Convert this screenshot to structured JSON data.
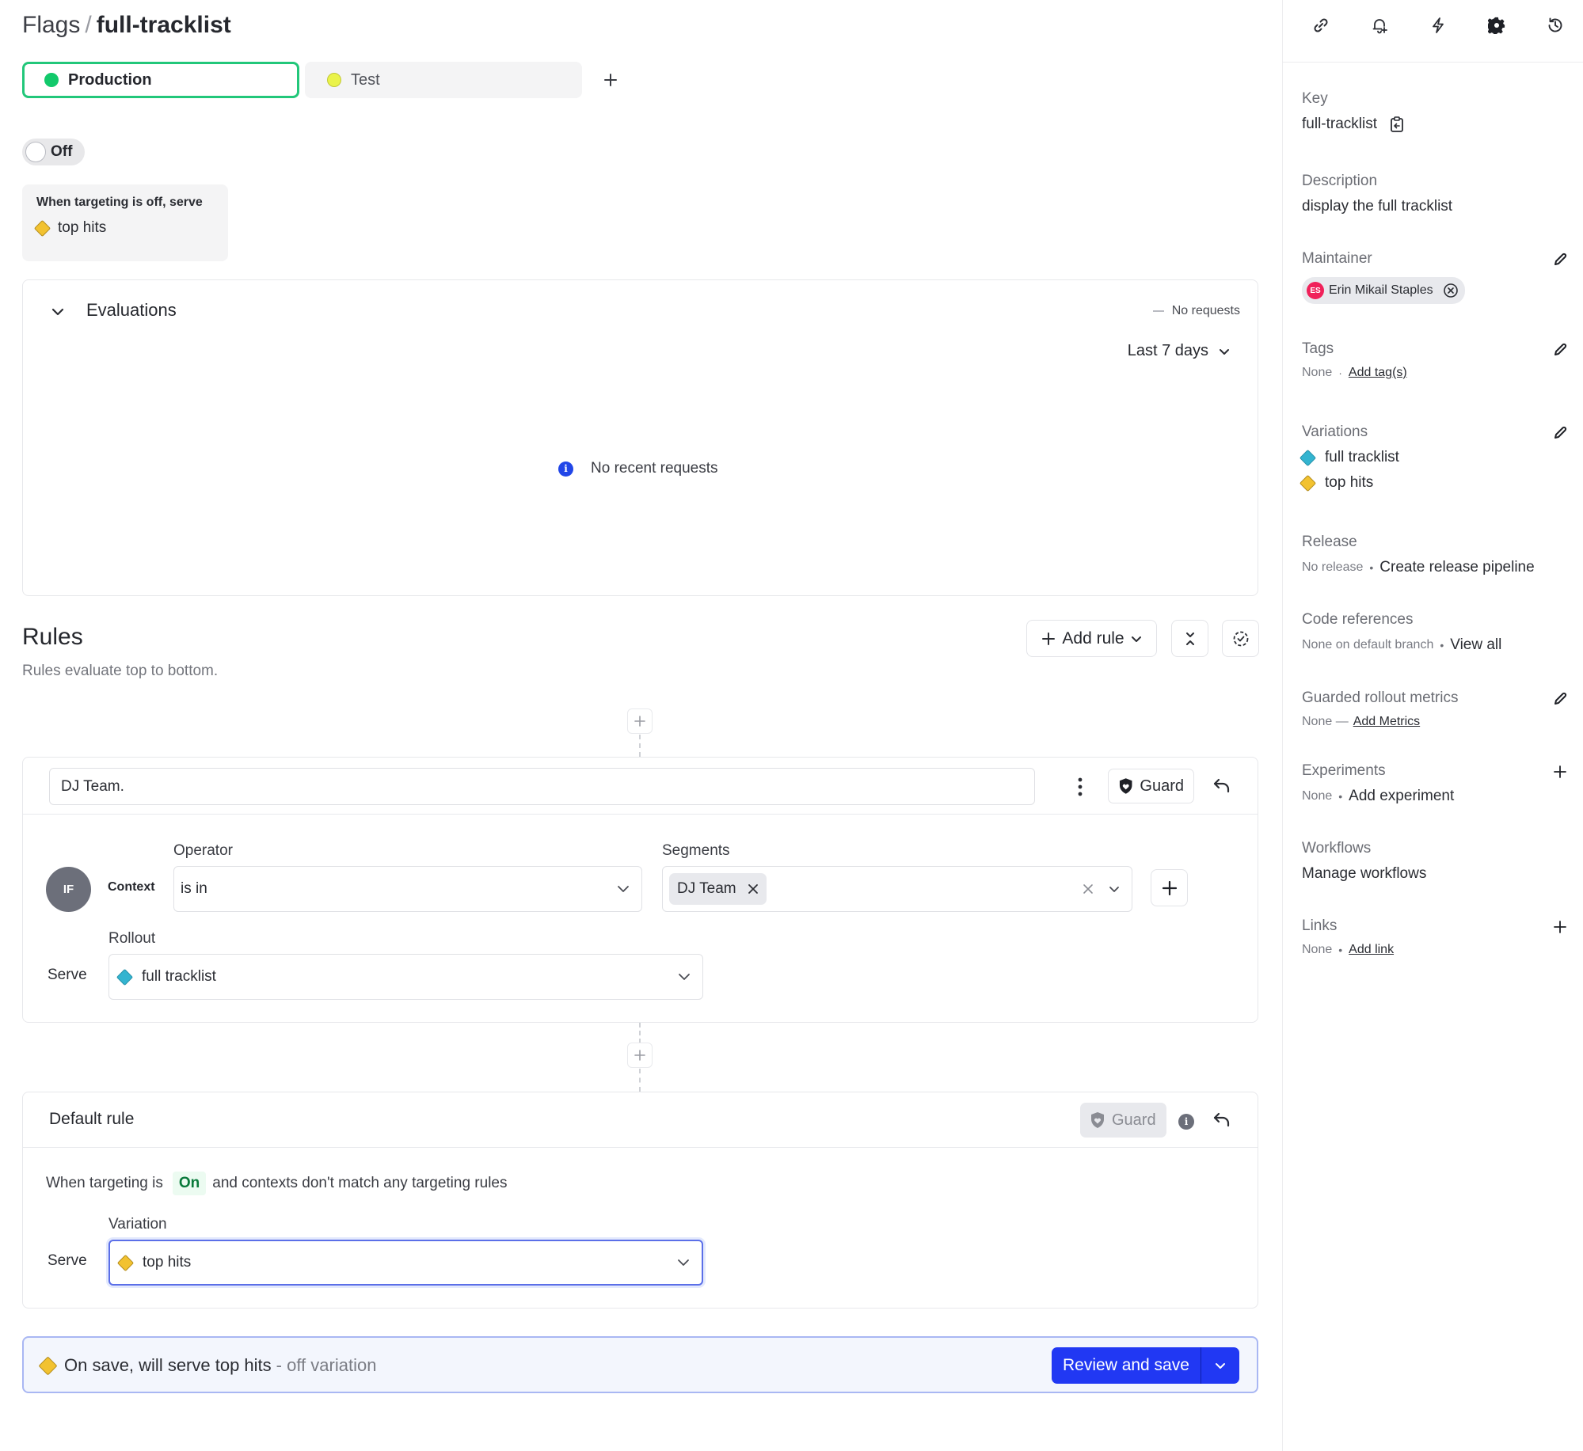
{
  "header": {
    "breadcrumb_root": "Flags",
    "separator": "/",
    "flag_name": "full-tracklist"
  },
  "environments": {
    "tabs": [
      {
        "label": "Production",
        "color": "#12c96b",
        "active": true
      },
      {
        "label": "Test",
        "color": "#eaf34a",
        "active": false
      }
    ],
    "add_icon": "plus-icon"
  },
  "targeting_toggle": {
    "state": "Off"
  },
  "off_serve": {
    "heading": "When targeting is off, serve",
    "variation": "top hits"
  },
  "evaluations": {
    "title": "Evaluations",
    "status": "No requests",
    "range": "Last 7 days",
    "empty_message": "No recent requests",
    "info_glyph": "i"
  },
  "rules": {
    "title": "Rules",
    "subtitle": "Rules evaluate top to bottom.",
    "add_rule_label": "Add rule",
    "items": [
      {
        "name": "DJ Team.",
        "guard_label": "Guard",
        "if_badge": "IF",
        "context_label": "Context",
        "operator_label": "Operator",
        "operator_value": "is in",
        "segments_label": "Segments",
        "segments": [
          "DJ Team"
        ],
        "serve_label": "Serve",
        "rollout_label": "Rollout",
        "rollout_value": "full tracklist"
      }
    ]
  },
  "default_rule": {
    "title": "Default rule",
    "guard_label": "Guard",
    "info_glyph": "i",
    "when_prefix": "When targeting is",
    "when_state": "On",
    "when_suffix": "and contexts don't match any targeting rules",
    "variation_label": "Variation",
    "serve_label": "Serve",
    "variation_value": "top hits"
  },
  "save_bar": {
    "message": "On save, will serve top hits",
    "muted": "- off variation",
    "button_label": "Review and save"
  },
  "sidebar": {
    "toolbar_icons": [
      "link-icon",
      "bell-plus-icon",
      "bolt-icon",
      "gear-icon",
      "history-icon"
    ],
    "key": {
      "label": "Key",
      "value": "full-tracklist"
    },
    "description": {
      "label": "Description",
      "value": "display the full tracklist"
    },
    "maintainer": {
      "label": "Maintainer",
      "initials": "ES",
      "name": "Erin Mikail Staples"
    },
    "tags": {
      "label": "Tags",
      "none": "None",
      "sep": "·",
      "link": "Add tag(s)"
    },
    "variations": {
      "label": "Variations",
      "items": [
        {
          "name": "full tracklist",
          "color": "#33b4d0"
        },
        {
          "name": "top hits",
          "color": "#f2c230"
        }
      ]
    },
    "release": {
      "label": "Release",
      "none": "No release",
      "sep": "•",
      "link": "Create release pipeline"
    },
    "code_references": {
      "label": "Code references",
      "none": "None on default branch",
      "sep": "•",
      "link": "View all"
    },
    "guarded_metrics": {
      "label": "Guarded rollout metrics",
      "none": "None —",
      "link": "Add Metrics"
    },
    "experiments": {
      "label": "Experiments",
      "none": "None",
      "sep": "•",
      "link": "Add experiment"
    },
    "workflows": {
      "label": "Workflows",
      "link": "Manage workflows"
    },
    "links": {
      "label": "Links",
      "none": "None",
      "sep": "•",
      "link": "Add link"
    }
  }
}
